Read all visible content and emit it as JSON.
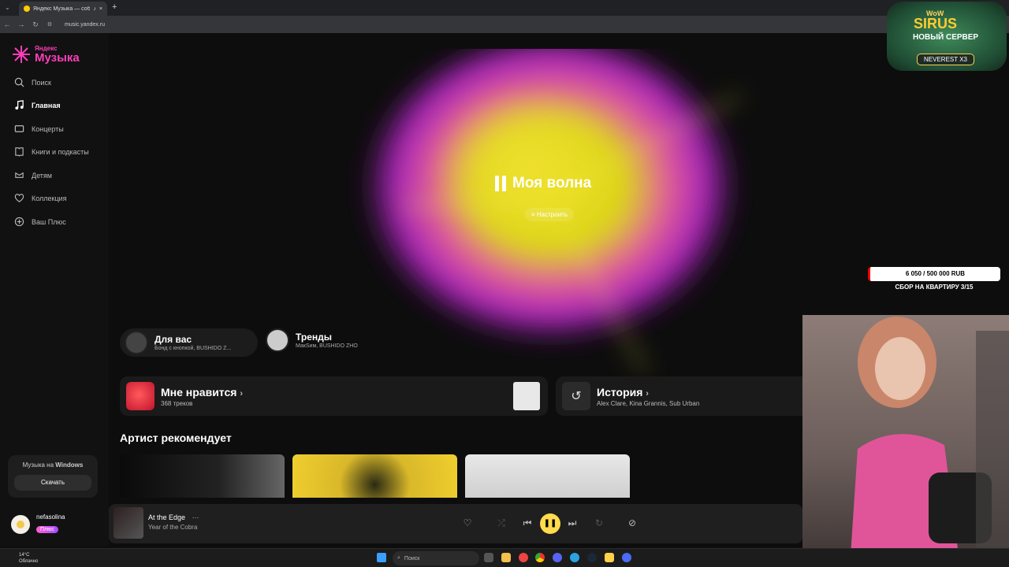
{
  "browser": {
    "tab_title": "Яндекс Музыка — собираем…",
    "url": "music.yandex.ru",
    "new_tab": "+",
    "close": "×"
  },
  "sidebar": {
    "logo_small": "Яндекс",
    "logo_big": "Музыка",
    "items": [
      {
        "label": "Поиск",
        "icon": "search-icon"
      },
      {
        "label": "Главная",
        "icon": "music-note-icon",
        "active": true
      },
      {
        "label": "Концерты",
        "icon": "ticket-icon"
      },
      {
        "label": "Книги и подкасты",
        "icon": "book-icon"
      },
      {
        "label": "Детям",
        "icon": "kids-icon"
      },
      {
        "label": "Коллекция",
        "icon": "heart-icon"
      },
      {
        "label": "Ваш Плюс",
        "icon": "plus-icon"
      }
    ],
    "windows_promo": {
      "prefix": "Музыка на",
      "bold": "Windows",
      "button": "Скачать"
    },
    "user": {
      "name": "nefasolina",
      "badge": "Плюс"
    }
  },
  "hero": {
    "title": "Моя волна",
    "tune_label": "Настроить"
  },
  "pills": [
    {
      "title": "Для вас",
      "subtitle": "Бонд с кнопкой, BUSHIDO Z..."
    },
    {
      "title": "Тренды",
      "subtitle": "МакSим, BUSHIDO ZHO"
    }
  ],
  "cards": {
    "likes": {
      "title": "Мне нравится",
      "subtitle": "368 треков"
    },
    "history": {
      "title": "История",
      "subtitle": "Alex Clare, Kina Grannis, Sub Urban"
    }
  },
  "section": {
    "title": "Артист рекомендует"
  },
  "player": {
    "track": "At the Edge",
    "artist": "Year of the Cobra",
    "more": "···"
  },
  "overlay": {
    "wow_top": "WoW",
    "wow_brand": "SIRUS",
    "wow_server": "НОВЫЙ СЕРВЕР",
    "wow_realm": "NEVEREST X3",
    "donation_progress": "6 050 / 500 000 RUB",
    "donation_goal": "СБОР НА КВАРТИРУ 3/15"
  },
  "taskbar": {
    "weather_temp": "14°C",
    "weather_desc": "Облачно",
    "search_placeholder": "Поиск"
  },
  "colors": {
    "accent_pink": "#ff3dbb",
    "play_yellow": "#ffdb4d",
    "bg": "#0d0d0d"
  }
}
